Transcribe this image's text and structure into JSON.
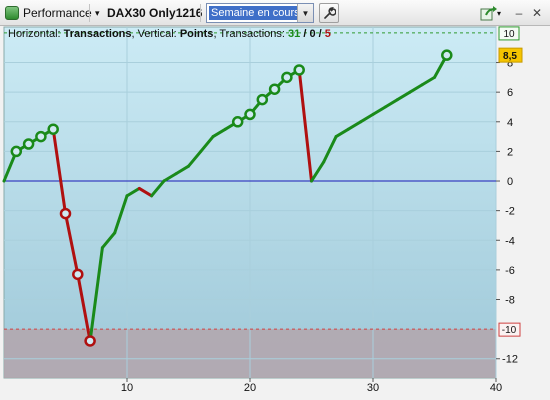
{
  "toolbar": {
    "performance_label": "Performance",
    "strategy_label": "DAX30 Only1216",
    "period_value": "Semaine en cours",
    "dropdown_caret": "▼",
    "menu_caret": "▾",
    "minimize_glyph": "–",
    "close_glyph": "✕",
    "export_icon": "export-icon",
    "wrench_icon": "wrench-icon"
  },
  "legend": {
    "horizontal_prefix": "Horizontal:",
    "horizontal_value": "Transactions",
    "vertical_prefix": ", Vertical:",
    "vertical_value": "Points",
    "transactions_prefix": ", Transactions:",
    "wins": "31",
    "sep1": " / ",
    "neutral": "0",
    "sep2": " / ",
    "losses": "5"
  },
  "colors": {
    "win": "#1a8a1a",
    "loss": "#b01010",
    "zero_line": "#1a1ab8",
    "bg_top": "#ccebf5",
    "bg_bottom": "#9ec8d8",
    "loss_zone": "#b4a4ac",
    "current_badge": "#f5c400"
  },
  "chart_data": {
    "type": "line",
    "xlabel": "",
    "ylabel": "",
    "xlim": [
      0,
      40
    ],
    "ylim": [
      -13.3,
      10.4
    ],
    "x_ticks": [
      10,
      20,
      30,
      40
    ],
    "y_ticks": [
      8,
      6,
      4,
      2,
      0,
      -2,
      -4,
      -6,
      -8,
      -12
    ],
    "upper_level": 10,
    "lower_level": -10,
    "current_value": 8.5,
    "upper_level_label": "10",
    "lower_level_label": "-10",
    "current_value_label": "8,5",
    "grid": true,
    "series": [
      {
        "points": [
          {
            "x": 0,
            "y": 0.0,
            "r": "win"
          },
          {
            "x": 1,
            "y": 2.0,
            "r": "win"
          },
          {
            "x": 2,
            "y": 2.5,
            "r": "win"
          },
          {
            "x": 3,
            "y": 3.0,
            "r": "win"
          },
          {
            "x": 4,
            "y": 3.5,
            "r": "win"
          },
          {
            "x": 5,
            "y": -2.2,
            "r": "loss"
          },
          {
            "x": 6,
            "y": -6.3,
            "r": "loss"
          },
          {
            "x": 7,
            "y": -10.8,
            "r": "loss"
          },
          {
            "x": 8,
            "y": -4.5,
            "r": "win"
          },
          {
            "x": 9,
            "y": -3.5,
            "r": "win"
          },
          {
            "x": 10,
            "y": -1.0,
            "r": "win"
          },
          {
            "x": 11,
            "y": -0.5,
            "r": "win"
          },
          {
            "x": 12,
            "y": -1.0,
            "r": "loss"
          },
          {
            "x": 13,
            "y": 0.0,
            "r": "win"
          },
          {
            "x": 14,
            "y": 0.5,
            "r": "win"
          },
          {
            "x": 15,
            "y": 1.0,
            "r": "win"
          },
          {
            "x": 16,
            "y": 2.0,
            "r": "win"
          },
          {
            "x": 17,
            "y": 3.0,
            "r": "win"
          },
          {
            "x": 18,
            "y": 3.5,
            "r": "win"
          },
          {
            "x": 19,
            "y": 4.0,
            "r": "win"
          },
          {
            "x": 20,
            "y": 4.5,
            "r": "win"
          },
          {
            "x": 21,
            "y": 5.5,
            "r": "win"
          },
          {
            "x": 22,
            "y": 6.2,
            "r": "win"
          },
          {
            "x": 23,
            "y": 7.0,
            "r": "win"
          },
          {
            "x": 24,
            "y": 7.5,
            "r": "win"
          },
          {
            "x": 25,
            "y": 0.0,
            "r": "loss"
          },
          {
            "x": 26,
            "y": 1.3,
            "r": "win"
          },
          {
            "x": 27,
            "y": 3.0,
            "r": "win"
          },
          {
            "x": 28,
            "y": 3.5,
            "r": "win"
          },
          {
            "x": 29,
            "y": 4.0,
            "r": "win"
          },
          {
            "x": 30,
            "y": 4.5,
            "r": "win"
          },
          {
            "x": 31,
            "y": 5.0,
            "r": "win"
          },
          {
            "x": 32,
            "y": 5.5,
            "r": "win"
          },
          {
            "x": 33,
            "y": 6.0,
            "r": "win"
          },
          {
            "x": 34,
            "y": 6.5,
            "r": "win"
          },
          {
            "x": 35,
            "y": 7.0,
            "r": "win"
          },
          {
            "x": 36,
            "y": 8.5,
            "r": "win"
          }
        ],
        "markers": [
          1,
          2,
          3,
          4,
          5,
          6,
          7,
          19,
          20,
          21,
          22,
          23,
          24,
          36
        ]
      }
    ]
  }
}
